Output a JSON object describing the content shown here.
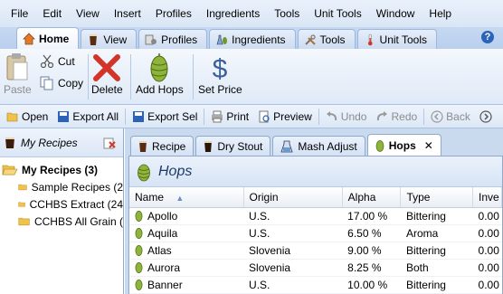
{
  "menu": [
    "File",
    "Edit",
    "View",
    "Insert",
    "Profiles",
    "Ingredients",
    "Tools",
    "Unit Tools",
    "Window",
    "Help"
  ],
  "ribbon_tabs": [
    {
      "label": "Home",
      "icon": "home-icon",
      "active": true
    },
    {
      "label": "View",
      "icon": "glass-icon",
      "active": false
    },
    {
      "label": "Profiles",
      "icon": "profiles-icon",
      "active": false
    },
    {
      "label": "Ingredients",
      "icon": "ingredients-icon",
      "active": false
    },
    {
      "label": "Tools",
      "icon": "tools-icon",
      "active": false
    },
    {
      "label": "Unit Tools",
      "icon": "thermometer-icon",
      "active": false
    }
  ],
  "ribbon": {
    "paste": "Paste",
    "cut": "Cut",
    "copy": "Copy",
    "delete": "Delete",
    "add_hops": "Add Hops",
    "set_price": "Set Price"
  },
  "toolbar": {
    "open": "Open",
    "export_all": "Export All",
    "export_sel": "Export Sel",
    "print": "Print",
    "preview": "Preview",
    "undo": "Undo",
    "redo": "Redo",
    "back": "Back"
  },
  "left_panel": {
    "title": "My Recipes",
    "tree": {
      "root": "My Recipes (3)",
      "children": [
        "Sample Recipes (2",
        "CCHBS Extract (24",
        "CCHBS All Grain ("
      ]
    }
  },
  "doc_tabs": [
    {
      "label": "Recipe",
      "icon": "glass-icon",
      "active": false
    },
    {
      "label": "Dry Stout",
      "icon": "stout-glass-icon",
      "active": false
    },
    {
      "label": "Mash Adjust",
      "icon": "mash-adjust-icon",
      "active": false
    },
    {
      "label": "Hops",
      "icon": "hop-icon",
      "active": true,
      "close": "✕"
    }
  ],
  "doc": {
    "title": "Hops",
    "columns": [
      "Name",
      "Origin",
      "Alpha",
      "Type",
      "Inve"
    ],
    "sort_indicator": "▲",
    "rows": [
      {
        "name": "Apollo",
        "origin": "U.S.",
        "alpha": "17.00 %",
        "type": "Bittering",
        "inv": "0.00"
      },
      {
        "name": "Aquila",
        "origin": "U.S.",
        "alpha": "6.50 %",
        "type": "Aroma",
        "inv": "0.00"
      },
      {
        "name": "Atlas",
        "origin": "Slovenia",
        "alpha": "9.00 %",
        "type": "Bittering",
        "inv": "0.00"
      },
      {
        "name": "Aurora",
        "origin": "Slovenia",
        "alpha": "8.25 %",
        "type": "Both",
        "inv": "0.00"
      },
      {
        "name": "Banner",
        "origin": "U.S.",
        "alpha": "10.00 %",
        "type": "Bittering",
        "inv": "0.00"
      }
    ]
  },
  "colors": {
    "hop_green": "#6f9a2a",
    "accent_blue": "#2a63b8",
    "delete_red": "#d3342a"
  }
}
